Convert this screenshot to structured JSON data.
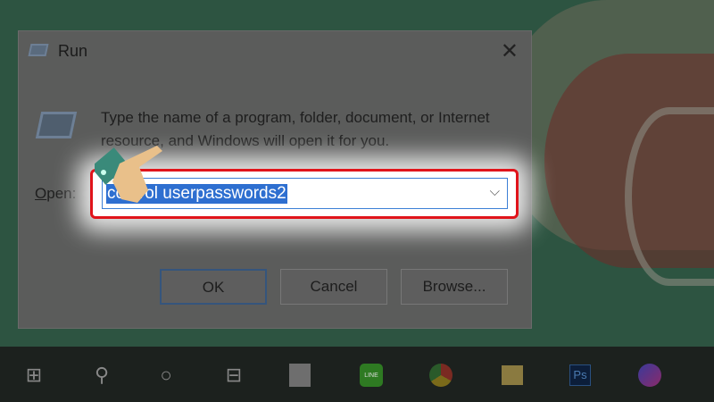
{
  "dialog": {
    "title": "Run",
    "description": "Type the name of a program, folder, document, or Internet resource, and Windows will open it for you.",
    "open_label_mnemonic": "O",
    "open_label_rest": "pen:",
    "open_value": "control userpasswords2",
    "ok_label": "OK",
    "cancel_label": "Cancel",
    "browse_label": "Browse..."
  },
  "taskbar": {
    "items": [
      "start",
      "search",
      "cortana",
      "task-view",
      "store",
      "line",
      "chrome",
      "file-explorer",
      "photoshop",
      "messenger"
    ],
    "ps_label": "Ps",
    "line_label": "LINE"
  },
  "colors": {
    "highlight": "#e0141b",
    "selection": "#2e6fd0"
  }
}
